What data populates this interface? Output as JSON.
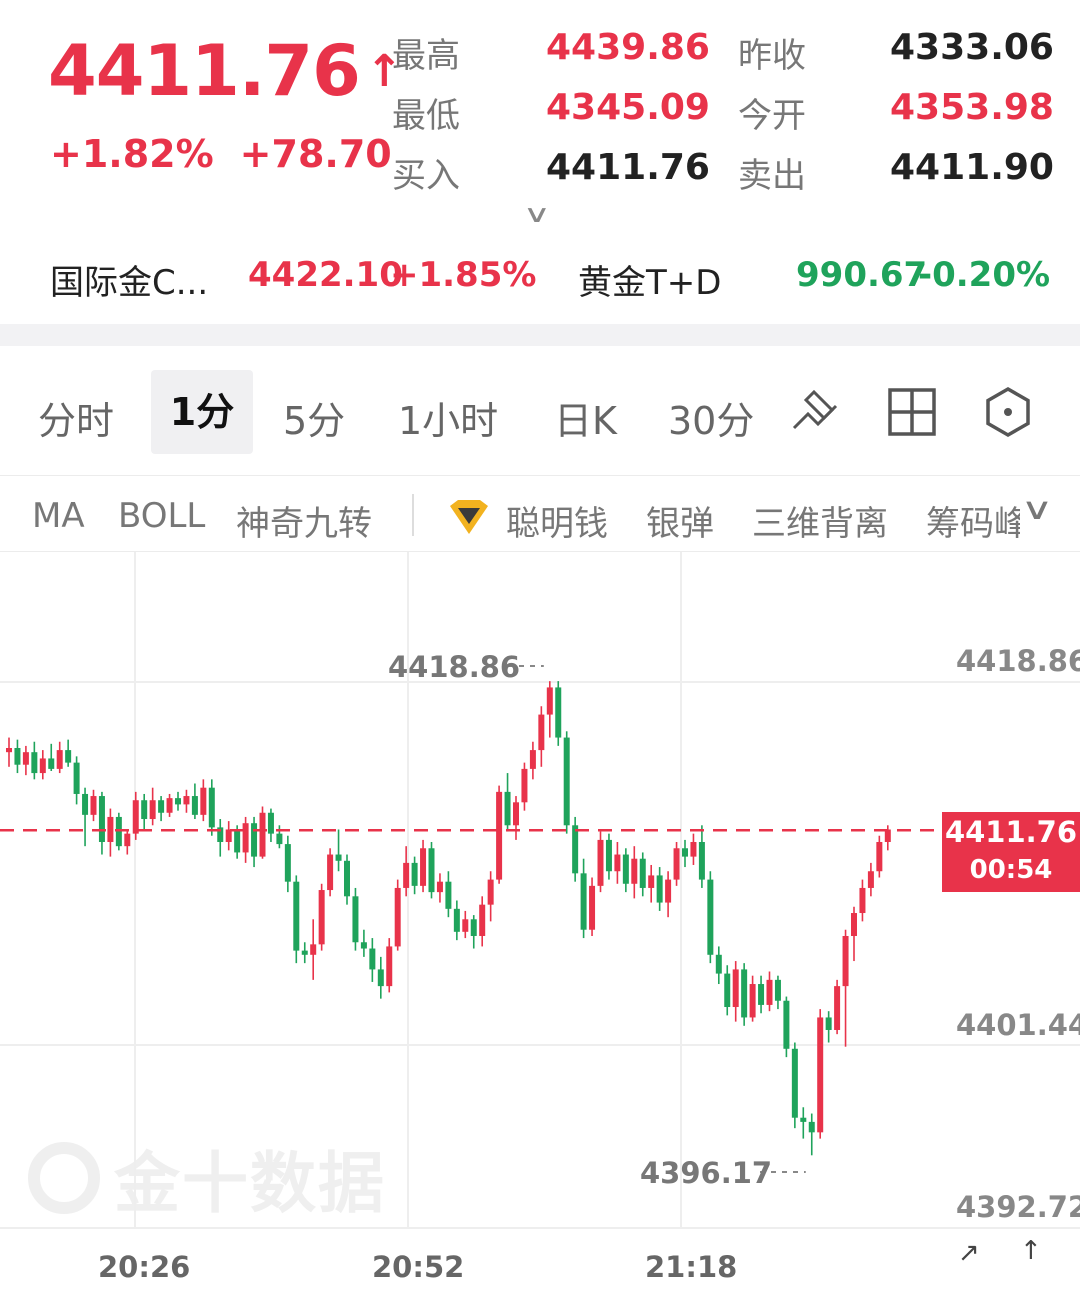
{
  "quote": {
    "price": "4411.76",
    "price_arrow": "↑",
    "change_pct": "+1.82%",
    "change_abs": "+78.70",
    "stats": {
      "high_label": "最高",
      "high_value": "4439.86",
      "low_label": "最低",
      "low_value": "4345.09",
      "bid_label": "买入",
      "bid_value": "4411.76",
      "prev_close_label": "昨收",
      "prev_close_value": "4333.06",
      "open_label": "今开",
      "open_value": "4353.98",
      "ask_label": "卖出",
      "ask_value": "4411.90"
    },
    "expand_icon": "chevron-down",
    "related": [
      {
        "name": "国际金C...",
        "price": "4422.10",
        "change": "+1.85%"
      },
      {
        "name": "黄金T+D",
        "price": "990.67",
        "change": "-0.20%"
      }
    ]
  },
  "tabs": {
    "items": [
      "分时",
      "1分",
      "5分",
      "1小时",
      "日K",
      "30分"
    ],
    "active": "1分",
    "tools": [
      "draw-icon",
      "grid-icon",
      "settings-hex-icon"
    ]
  },
  "indicators": {
    "items": [
      "MA",
      "BOLL",
      "神奇九转",
      "聪明钱",
      "银弹",
      "三维背离",
      "筹码峰"
    ],
    "premium_icon": "diamond-icon",
    "more_icon": "chevron-down"
  },
  "chart": {
    "y_labels": [
      "4418.86",
      "4401.44",
      "4392.72"
    ],
    "x_labels": [
      "20:26",
      "20:52",
      "21:18"
    ],
    "high_annotation": "4418.86",
    "low_annotation": "4396.17",
    "current_price": "4411.76",
    "countdown": "00:54",
    "watermark": "金十数据",
    "up_color": "#e8334a",
    "down_color": "#1fa35b"
  },
  "chart_data": {
    "type": "candlestick",
    "y_axis_ticks": [
      4418.86,
      4401.44,
      4392.72
    ],
    "x_ticks": [
      "20:26",
      "20:52",
      "21:18"
    ],
    "current": 4411.76,
    "candles": [
      [
        4415.5,
        4416.2,
        4414.8,
        4415.7
      ],
      [
        4415.7,
        4416.1,
        4414.5,
        4414.9
      ],
      [
        4414.9,
        4415.8,
        4414.4,
        4415.5
      ],
      [
        4415.5,
        4416.0,
        4414.2,
        4414.5
      ],
      [
        4414.5,
        4415.6,
        4414.2,
        4415.2
      ],
      [
        4415.2,
        4415.9,
        4414.6,
        4414.7
      ],
      [
        4414.7,
        4416.0,
        4414.5,
        4415.6
      ],
      [
        4415.6,
        4416.1,
        4414.8,
        4415.0
      ],
      [
        4415.0,
        4415.3,
        4413.0,
        4413.5
      ],
      [
        4413.5,
        4413.8,
        4411.0,
        4412.5
      ],
      [
        4412.5,
        4413.7,
        4412.2,
        4413.4
      ],
      [
        4413.4,
        4413.6,
        4410.6,
        4411.2
      ],
      [
        4411.2,
        4412.8,
        4410.5,
        4412.4
      ],
      [
        4412.4,
        4412.6,
        4410.8,
        4411.0
      ],
      [
        4411.0,
        4411.8,
        4410.6,
        4411.6
      ],
      [
        4411.6,
        4413.6,
        4411.3,
        4413.2
      ],
      [
        4413.2,
        4413.5,
        4411.8,
        4412.3
      ],
      [
        4412.3,
        4413.8,
        4412.0,
        4413.2
      ],
      [
        4413.2,
        4413.4,
        4412.2,
        4412.6
      ],
      [
        4412.6,
        4413.5,
        4412.4,
        4413.3
      ],
      [
        4413.3,
        4413.6,
        4412.7,
        4413.0
      ],
      [
        4413.0,
        4413.7,
        4412.6,
        4413.4
      ],
      [
        4413.4,
        4414.0,
        4412.3,
        4412.5
      ],
      [
        4412.5,
        4414.2,
        4412.2,
        4413.8
      ],
      [
        4413.8,
        4414.2,
        4411.5,
        4411.9
      ],
      [
        4411.9,
        4412.3,
        4410.5,
        4411.2
      ],
      [
        4411.2,
        4412.2,
        4410.8,
        4411.8
      ],
      [
        4411.8,
        4412.0,
        4410.4,
        4410.7
      ],
      [
        4410.7,
        4412.4,
        4410.2,
        4412.1
      ],
      [
        4412.1,
        4412.4,
        4410.0,
        4410.5
      ],
      [
        4410.5,
        4412.9,
        4410.4,
        4412.6
      ],
      [
        4412.6,
        4412.8,
        4411.2,
        4411.6
      ],
      [
        4411.6,
        4412.0,
        4410.9,
        4411.1
      ],
      [
        4411.1,
        4411.5,
        4408.8,
        4409.3
      ],
      [
        4409.3,
        4409.6,
        4405.4,
        4406.0
      ],
      [
        4406.0,
        4406.4,
        4405.4,
        4405.8
      ],
      [
        4405.8,
        4407.5,
        4404.6,
        4406.3
      ],
      [
        4406.3,
        4409.2,
        4406.0,
        4408.9
      ],
      [
        4408.9,
        4410.9,
        4408.6,
        4410.6
      ],
      [
        4410.6,
        4411.8,
        4409.8,
        4410.3
      ],
      [
        4410.3,
        4410.6,
        4408.2,
        4408.6
      ],
      [
        4408.6,
        4409.0,
        4406.0,
        4406.4
      ],
      [
        4406.4,
        4407.0,
        4405.7,
        4406.1
      ],
      [
        4406.1,
        4406.6,
        4404.5,
        4405.1
      ],
      [
        4405.1,
        4405.7,
        4403.7,
        4404.3
      ],
      [
        4404.3,
        4406.6,
        4404.0,
        4406.2
      ],
      [
        4406.2,
        4409.4,
        4406.0,
        4409.0
      ],
      [
        4409.0,
        4411.0,
        4408.6,
        4410.2
      ],
      [
        4410.2,
        4410.5,
        4408.7,
        4409.1
      ],
      [
        4409.1,
        4411.3,
        4408.8,
        4410.9
      ],
      [
        4410.9,
        4411.2,
        4408.5,
        4408.8
      ],
      [
        4408.8,
        4409.7,
        4408.3,
        4409.3
      ],
      [
        4409.3,
        4409.8,
        4407.6,
        4408.0
      ],
      [
        4408.0,
        4408.4,
        4406.5,
        4406.9
      ],
      [
        4406.9,
        4407.9,
        4406.6,
        4407.5
      ],
      [
        4407.5,
        4407.7,
        4406.1,
        4406.7
      ],
      [
        4406.7,
        4408.6,
        4406.2,
        4408.2
      ],
      [
        4408.2,
        4409.8,
        4407.4,
        4409.4
      ],
      [
        4409.4,
        4413.9,
        4409.2,
        4413.6
      ],
      [
        4413.6,
        4414.5,
        4411.7,
        4412.0
      ],
      [
        4412.0,
        4413.4,
        4411.3,
        4413.1
      ],
      [
        4413.1,
        4415.0,
        4412.7,
        4414.7
      ],
      [
        4414.7,
        4416.0,
        4414.2,
        4415.6
      ],
      [
        4415.6,
        4417.7,
        4414.8,
        4417.3
      ],
      [
        4417.3,
        4418.9,
        4416.2,
        4418.6
      ],
      [
        4418.6,
        4418.9,
        4415.8,
        4416.2
      ],
      [
        4416.2,
        4416.5,
        4411.6,
        4412.0
      ],
      [
        4412.0,
        4412.4,
        4409.3,
        4409.7
      ],
      [
        4409.7,
        4410.4,
        4406.6,
        4407.0
      ],
      [
        4407.0,
        4409.5,
        4406.7,
        4409.1
      ],
      [
        4409.1,
        4411.7,
        4408.8,
        4411.3
      ],
      [
        4411.3,
        4411.6,
        4409.4,
        4409.8
      ],
      [
        4409.8,
        4411.2,
        4409.2,
        4410.6
      ],
      [
        4410.6,
        4410.9,
        4408.8,
        4409.2
      ],
      [
        4409.2,
        4411.0,
        4408.5,
        4410.4
      ],
      [
        4410.4,
        4410.7,
        4408.6,
        4409.0
      ],
      [
        4409.0,
        4410.1,
        4408.3,
        4409.6
      ],
      [
        4409.6,
        4410.0,
        4407.9,
        4408.3
      ],
      [
        4408.3,
        4409.8,
        4407.6,
        4409.4
      ],
      [
        4409.4,
        4411.2,
        4409.1,
        4410.9
      ],
      [
        4410.9,
        4411.3,
        4410.0,
        4410.5
      ],
      [
        4410.5,
        4411.6,
        4410.1,
        4411.2
      ],
      [
        4411.2,
        4412.0,
        4409.0,
        4409.4
      ],
      [
        4409.4,
        4409.8,
        4405.4,
        4405.8
      ],
      [
        4405.8,
        4406.2,
        4404.4,
        4404.9
      ],
      [
        4404.9,
        4405.3,
        4402.9,
        4403.3
      ],
      [
        4403.3,
        4405.5,
        4402.6,
        4405.1
      ],
      [
        4405.1,
        4405.4,
        4402.4,
        4402.8
      ],
      [
        4402.8,
        4404.8,
        4402.6,
        4404.4
      ],
      [
        4404.4,
        4404.8,
        4403.0,
        4403.4
      ],
      [
        4403.4,
        4405.0,
        4403.1,
        4404.6
      ],
      [
        4404.6,
        4404.8,
        4403.2,
        4403.6
      ],
      [
        4403.6,
        4403.8,
        4400.9,
        4401.3
      ],
      [
        4401.3,
        4401.6,
        4397.5,
        4398.0
      ],
      [
        4398.0,
        4398.5,
        4397.0,
        4397.8
      ],
      [
        4397.8,
        4398.2,
        4396.2,
        4397.3
      ],
      [
        4397.3,
        4403.2,
        4397.0,
        4402.8
      ],
      [
        4402.8,
        4403.1,
        4401.6,
        4402.2
      ],
      [
        4402.2,
        4404.6,
        4402.0,
        4404.3
      ],
      [
        4404.3,
        4407.0,
        4401.4,
        4406.7
      ],
      [
        4406.7,
        4408.1,
        4405.5,
        4407.8
      ],
      [
        4407.8,
        4409.4,
        4407.4,
        4409.0
      ],
      [
        4409.0,
        4410.2,
        4408.6,
        4409.8
      ],
      [
        4409.8,
        4411.5,
        4409.5,
        4411.2
      ],
      [
        4411.2,
        4412.0,
        4410.8,
        4411.8
      ]
    ]
  }
}
